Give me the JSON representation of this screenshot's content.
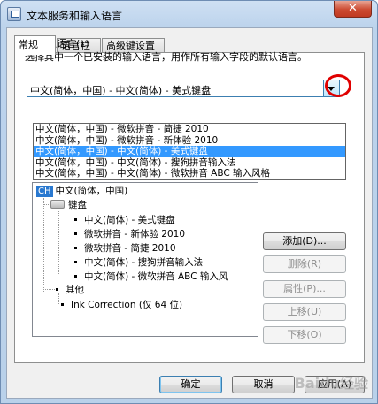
{
  "window": {
    "title": "文本服务和输入语言",
    "close_symbol": "✕"
  },
  "tabs": [
    {
      "label": "常规"
    },
    {
      "label": "语言栏"
    },
    {
      "label": "高级键设置"
    }
  ],
  "default_language": {
    "label": "默认输入语言(L)",
    "description": "选择其中一个已安装的输入语言，用作所有输入字段的默认语言。",
    "selected": "中文(简体，中国) - 中文(简体) - 美式键盘",
    "options": [
      "中文(简体，中国) - 微软拼音 - 简捷 2010",
      "中文(简体，中国) - 微软拼音 - 新体验 2010",
      "中文(简体，中国) - 中文(简体) - 美式键盘",
      "中文(简体，中国) - 中文(简体) - 搜狗拼音输入法",
      "中文(简体，中国) - 中文(简体) - 微软拼音 ABC 输入风格"
    ],
    "highlighted_index": 2
  },
  "installed_services": {
    "language_badge": "CH",
    "language": "中文(简体，中国)",
    "keyboard_group": "键盘",
    "keyboards": [
      "中文(简体) - 美式键盘",
      "微软拼音 - 新体验 2010",
      "微软拼音 - 简捷 2010",
      "中文(简体) - 搜狗拼音输入法",
      "中文(简体) - 微软拼音 ABC 输入风"
    ],
    "other_group": "其他",
    "other_items": [
      "Ink Correction (仅 64 位)"
    ]
  },
  "side_buttons": {
    "add": "添加(D)...",
    "remove": "删除(R)",
    "properties": "属性(P)...",
    "move_up": "上移(U)",
    "move_down": "下移(O)"
  },
  "footer": {
    "ok": "确定",
    "cancel": "取消",
    "apply": "应用(A)"
  },
  "watermark": "Baidu经验"
}
